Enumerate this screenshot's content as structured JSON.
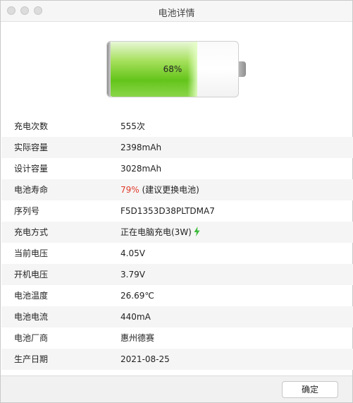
{
  "window": {
    "title": "电池详情"
  },
  "battery": {
    "percent_label": "68%",
    "level": 0.68,
    "fill_color": "#64c41a"
  },
  "info": {
    "rows": [
      {
        "label": "充电次数",
        "value": "555次"
      },
      {
        "label": "实际容量",
        "value": "2398mAh"
      },
      {
        "label": "设计容量",
        "value": "3028mAh"
      },
      {
        "label": "电池寿命",
        "value_highlight": "79%",
        "value_rest": " (建议更换电池)",
        "highlight_color": "#e03a2b"
      },
      {
        "label": "序列号",
        "value": "F5D1353D38PLTDMA7"
      },
      {
        "label": "充电方式",
        "value": "正在电脑充电(3W)",
        "icon": "lightning-bolt-icon",
        "icon_color": "#3dbb3d"
      },
      {
        "label": "当前电压",
        "value": "4.05V"
      },
      {
        "label": "开机电压",
        "value": "3.79V"
      },
      {
        "label": "电池温度",
        "value": "26.69℃"
      },
      {
        "label": "电池电流",
        "value": "440mA"
      },
      {
        "label": "电池厂商",
        "value": "惠州德赛"
      },
      {
        "label": "生产日期",
        "value": "2021-08-25"
      }
    ]
  },
  "footer": {
    "ok_label": "确定"
  }
}
